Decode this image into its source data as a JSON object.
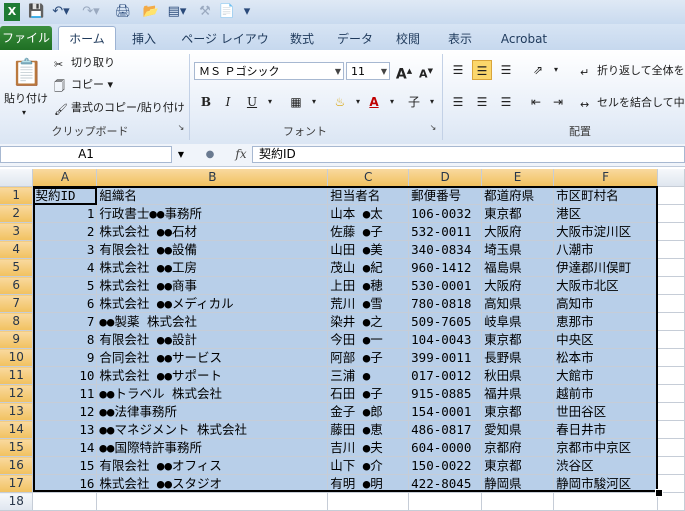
{
  "qat": {
    "save_icon": "save-icon",
    "undo_icon": "undo-icon",
    "redo_icon": "redo-icon"
  },
  "tabs": [
    "ファイル",
    "ホーム",
    "挿入",
    "ページ レイアウト",
    "数式",
    "データ",
    "校閲",
    "表示",
    "Acrobat"
  ],
  "ribbon": {
    "paste": "貼り付け",
    "cut": "切り取り",
    "copy": "コピー",
    "format_painter": "書式のコピー/貼り付け",
    "clipboard_group": "クリップボード",
    "font_name": "ＭＳ Ｐゴシック",
    "font_size": "11",
    "font_group": "フォント",
    "wrap_text": "折り返して全体を",
    "merge_center": "セルを結合して中",
    "alignment_group": "配置",
    "bold": "B",
    "italic": "I",
    "underline": "U",
    "grow_font": "A",
    "shrink_font": "A",
    "font_color": "A"
  },
  "formula_bar": {
    "name_box": "A1",
    "fx": "fx",
    "value": "契約ID"
  },
  "sheet": {
    "columns": [
      "A",
      "B",
      "C",
      "D",
      "E",
      "F"
    ],
    "rows": [
      {
        "n": "1",
        "cells": [
          "契約ID",
          "組織名",
          "担当者名",
          "郵便番号",
          "都道府県",
          "市区町村名"
        ]
      },
      {
        "n": "2",
        "cells": [
          "1",
          "行政書士●●事務所",
          "山本 ●太",
          "106-0032",
          "東京都",
          "港区"
        ]
      },
      {
        "n": "3",
        "cells": [
          "2",
          "株式会社 ●●石材",
          "佐藤 ●子",
          "532-0011",
          "大阪府",
          "大阪市淀川区"
        ]
      },
      {
        "n": "4",
        "cells": [
          "3",
          "有限会社 ●●設備",
          "山田 ●美",
          "340-0834",
          "埼玉県",
          "八潮市"
        ]
      },
      {
        "n": "5",
        "cells": [
          "4",
          "株式会社 ●●工房",
          "茂山 ●紀",
          "960-1412",
          "福島県",
          "伊達郡川俣町"
        ]
      },
      {
        "n": "6",
        "cells": [
          "5",
          "株式会社 ●●商事",
          "上田 ●穂",
          "530-0001",
          "大阪府",
          "大阪市北区"
        ]
      },
      {
        "n": "7",
        "cells": [
          "6",
          "株式会社 ●●メディカル",
          "荒川 ●雪",
          "780-0818",
          "高知県",
          "高知市"
        ]
      },
      {
        "n": "8",
        "cells": [
          "7",
          "●●製薬 株式会社",
          "染井 ●之",
          "509-7605",
          "岐阜県",
          "恵那市"
        ]
      },
      {
        "n": "9",
        "cells": [
          "8",
          "有限会社 ●●設計",
          "今田 ●一",
          "104-0043",
          "東京都",
          "中央区"
        ]
      },
      {
        "n": "10",
        "cells": [
          "9",
          "合同会社 ●●サービス",
          "阿部 ●子",
          "399-0011",
          "長野県",
          "松本市"
        ]
      },
      {
        "n": "11",
        "cells": [
          "10",
          "株式会社 ●●サポート",
          "三浦 ●",
          "017-0012",
          "秋田県",
          "大館市"
        ]
      },
      {
        "n": "12",
        "cells": [
          "11",
          "●●トラベル 株式会社",
          "石田 ●子",
          "915-0885",
          "福井県",
          "越前市"
        ]
      },
      {
        "n": "13",
        "cells": [
          "12",
          "●●法律事務所",
          "金子 ●郎",
          "154-0001",
          "東京都",
          "世田谷区"
        ]
      },
      {
        "n": "14",
        "cells": [
          "13",
          "●●マネジメント 株式会社",
          "藤田 ●恵",
          "486-0817",
          "愛知県",
          "春日井市"
        ]
      },
      {
        "n": "15",
        "cells": [
          "14",
          "●●国際特許事務所",
          "吉川 ●夫",
          "604-0000",
          "京都府",
          "京都市中京区"
        ]
      },
      {
        "n": "16",
        "cells": [
          "15",
          "有限会社 ●●オフィス",
          "山下 ●介",
          "150-0022",
          "東京都",
          "渋谷区"
        ]
      },
      {
        "n": "17",
        "cells": [
          "16",
          "株式会社 ●●スタジオ",
          "有明 ●明",
          "422-8045",
          "静岡県",
          "静岡市駿河区"
        ]
      },
      {
        "n": "18",
        "cells": [
          "",
          "",
          "",
          "",
          "",
          ""
        ]
      }
    ]
  },
  "colors": {
    "selection": "#b8cfe9",
    "file_tab": "#2a7d2e",
    "header_sel": "#f1c15f"
  }
}
